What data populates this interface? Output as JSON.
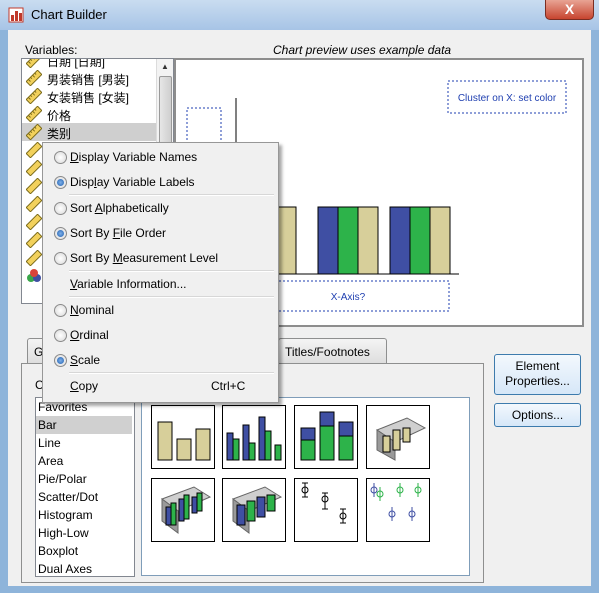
{
  "window": {
    "title": "Chart Builder",
    "close_glyph": "X"
  },
  "variables": {
    "label": "Variables:",
    "items": [
      {
        "label": "日期 [日期]",
        "icon": "scale-ruler-icon"
      },
      {
        "label": "男装销售 [男装]",
        "icon": "scale-ruler-icon"
      },
      {
        "label": "女装销售 [女装]",
        "icon": "scale-ruler-icon"
      },
      {
        "label": "价格",
        "icon": "scale-ruler-icon"
      },
      {
        "label": "类别",
        "icon": "scale-ruler-icon",
        "selected": true
      }
    ]
  },
  "preview": {
    "note": "Chart preview uses example data",
    "cluster_label": "Cluster on X: set color",
    "x_axis_label": "X-Axis?",
    "series_colors": [
      "#3f4fa3",
      "#2db34a",
      "#d7cf9a"
    ]
  },
  "context_menu": {
    "items": [
      {
        "pre": "",
        "u": "D",
        "post": "isplay Variable Names",
        "radio": true,
        "checked": false
      },
      {
        "pre": "Disp",
        "u": "l",
        "post": "ay Variable Labels",
        "radio": true,
        "checked": true
      },
      {
        "pre": "Sort ",
        "u": "A",
        "post": "lphabetically",
        "radio": true,
        "checked": false
      },
      {
        "pre": "Sort By ",
        "u": "F",
        "post": "ile Order",
        "radio": true,
        "checked": true
      },
      {
        "pre": "Sort By ",
        "u": "M",
        "post": "easurement Level",
        "radio": true,
        "checked": false
      },
      {
        "pre": "",
        "u": "V",
        "post": "ariable Information...",
        "radio": false,
        "checked": false
      },
      {
        "pre": "",
        "u": "N",
        "post": "ominal",
        "radio": true,
        "checked": false
      },
      {
        "pre": "",
        "u": "O",
        "post": "rdinal",
        "radio": true,
        "checked": false
      },
      {
        "pre": "",
        "u": "S",
        "post": "cale",
        "radio": true,
        "checked": true
      },
      {
        "pre": "",
        "u": "C",
        "post": "opy",
        "radio": false,
        "checked": false,
        "shortcut": "Ctrl+C"
      }
    ]
  },
  "tabs": [
    {
      "label": "G"
    },
    {
      "label": "Titles/Footnotes"
    }
  ],
  "gallery": {
    "choose_label": "C",
    "items": [
      "Favorites",
      "Bar",
      "Line",
      "Area",
      "Pie/Polar",
      "Scatter/Dot",
      "Histogram",
      "High-Low",
      "Boxplot",
      "Dual Axes"
    ],
    "selected": "Bar"
  },
  "buttons": {
    "element_properties": {
      "line1": "Element",
      "line2": "Properties..."
    },
    "options": "Options..."
  }
}
